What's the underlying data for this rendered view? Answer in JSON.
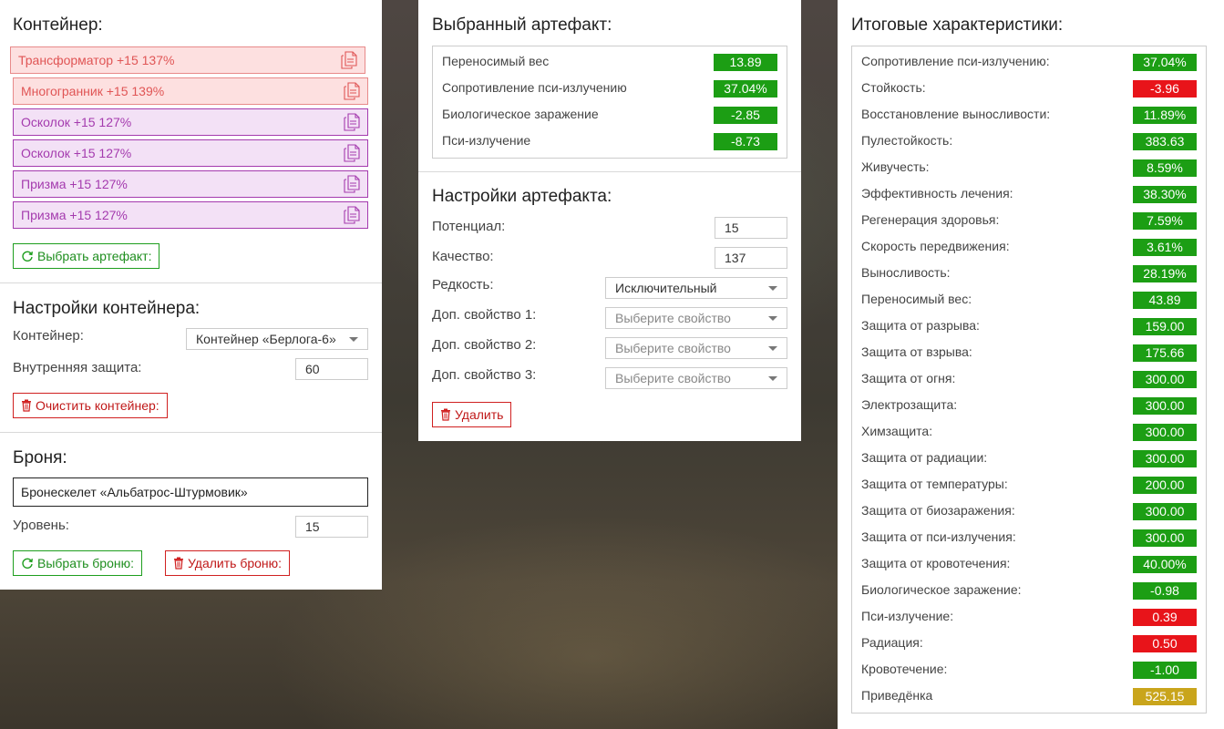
{
  "container_panel": {
    "title": "Контейнер:",
    "slots": [
      {
        "label": "Трансформатор +15 137%",
        "style": "red"
      },
      {
        "label": "Многогранник +15 139%",
        "style": "red"
      },
      {
        "label": "Осколок +15 127%",
        "style": "purple"
      },
      {
        "label": "Осколок +15 127%",
        "style": "purple"
      },
      {
        "label": "Призма +15 127%",
        "style": "purple"
      },
      {
        "label": "Призма +15 127%",
        "style": "purple"
      }
    ],
    "select_artifact_label": "Выбрать артефакт:"
  },
  "container_settings": {
    "title": "Настройки контейнера:",
    "container_label": "Контейнер:",
    "container_value": "Контейнер «Берлога-6»",
    "inner_protection_label": "Внутренняя защита:",
    "inner_protection_value": "60",
    "clear_label": "Очистить контейнер:"
  },
  "armor": {
    "title": "Броня:",
    "name": "Бронескелет «Альбатрос-Штурмовик»",
    "level_label": "Уровень:",
    "level_value": "15",
    "select_label": "Выбрать броню:",
    "delete_label": "Удалить броню:"
  },
  "selected_artifact": {
    "title": "Выбранный артефакт:",
    "stats": [
      {
        "name": "Переносимый вес",
        "value": "13.89",
        "color": "green"
      },
      {
        "name": "Сопротивление пси-излучению",
        "value": "37.04%",
        "color": "green"
      },
      {
        "name": "Биологическое заражение",
        "value": "-2.85",
        "color": "green"
      },
      {
        "name": "Пси-излучение",
        "value": "-8.73",
        "color": "green"
      }
    ]
  },
  "artifact_settings": {
    "title": "Настройки артефакта:",
    "potential_label": "Потенциал:",
    "potential_value": "15",
    "quality_label": "Качество:",
    "quality_value": "137",
    "rarity_label": "Редкость:",
    "rarity_value": "Исключительный",
    "prop1_label": "Доп. свойство 1:",
    "prop2_label": "Доп. свойство 2:",
    "prop3_label": "Доп. свойство 3:",
    "prop_placeholder": "Выберите свойство",
    "delete_label": "Удалить"
  },
  "totals": {
    "title": "Итоговые характеристики:",
    "stats": [
      {
        "name": "Сопротивление пси-излучению:",
        "value": "37.04%",
        "color": "green"
      },
      {
        "name": "Стойкость:",
        "value": "-3.96",
        "color": "red"
      },
      {
        "name": "Восстановление выносливости:",
        "value": "11.89%",
        "color": "green"
      },
      {
        "name": "Пулестойкость:",
        "value": "383.63",
        "color": "green"
      },
      {
        "name": "Живучесть:",
        "value": "8.59%",
        "color": "green"
      },
      {
        "name": "Эффективность лечения:",
        "value": "38.30%",
        "color": "green"
      },
      {
        "name": "Регенерация здоровья:",
        "value": "7.59%",
        "color": "green"
      },
      {
        "name": "Скорость передвижения:",
        "value": "3.61%",
        "color": "green"
      },
      {
        "name": "Выносливость:",
        "value": "28.19%",
        "color": "green"
      },
      {
        "name": "Переносимый вес:",
        "value": "43.89",
        "color": "green"
      },
      {
        "name": "Защита от разрыва:",
        "value": "159.00",
        "color": "green"
      },
      {
        "name": "Защита от взрыва:",
        "value": "175.66",
        "color": "green"
      },
      {
        "name": "Защита от огня:",
        "value": "300.00",
        "color": "green"
      },
      {
        "name": "Электрозащита:",
        "value": "300.00",
        "color": "green"
      },
      {
        "name": "Химзащита:",
        "value": "300.00",
        "color": "green"
      },
      {
        "name": "Защита от радиации:",
        "value": "300.00",
        "color": "green"
      },
      {
        "name": "Защита от температуры:",
        "value": "200.00",
        "color": "green"
      },
      {
        "name": "Защита от биозаражения:",
        "value": "300.00",
        "color": "green"
      },
      {
        "name": "Защита от пси-излучения:",
        "value": "300.00",
        "color": "green"
      },
      {
        "name": "Защита от кровотечения:",
        "value": "40.00%",
        "color": "green"
      },
      {
        "name": "Биологическое заражение:",
        "value": "-0.98",
        "color": "green"
      },
      {
        "name": "Пси-излучение:",
        "value": "0.39",
        "color": "red"
      },
      {
        "name": "Радиация:",
        "value": "0.50",
        "color": "red"
      },
      {
        "name": "Кровотечение:",
        "value": "-1.00",
        "color": "green"
      },
      {
        "name": "Приведёнка",
        "value": "525.15",
        "color": "gold"
      }
    ]
  }
}
